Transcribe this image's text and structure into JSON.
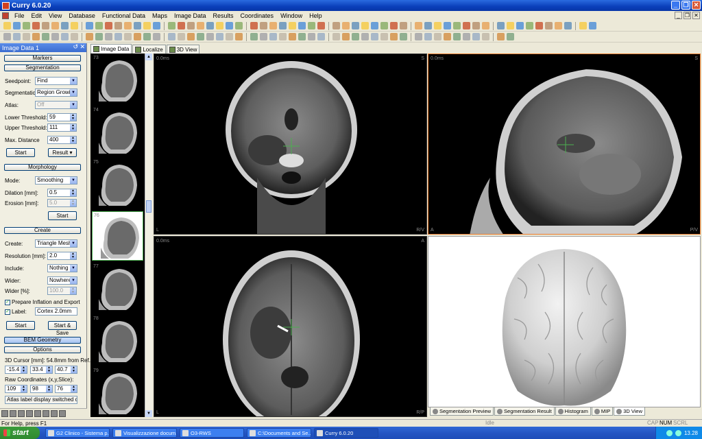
{
  "window": {
    "title": "Curry 6.0.20"
  },
  "menu": [
    "File",
    "Edit",
    "View",
    "Database",
    "Functional Data",
    "Maps",
    "Image Data",
    "Results",
    "Coordinates",
    "Window",
    "Help"
  ],
  "left_panel": {
    "title": "Image Data 1",
    "markers_label": "Markers",
    "segmentation": {
      "header": "Segmentation",
      "seedpoint_label": "Seedpoint:",
      "seedpoint_value": "Find",
      "segmentation_label": "Segmentation:",
      "segmentation_value": "Region Growing",
      "atlas_label": "Atlas:",
      "atlas_value": "Off",
      "lower_label": "Lower Threshold:",
      "lower_value": "59",
      "upper_label": "Upper Threshold:",
      "upper_value": "111",
      "maxdist_label": "Max. Distance",
      "maxdist_value": "400",
      "start_label": "Start",
      "result_label": "Result"
    },
    "morphology": {
      "header": "Morphology",
      "mode_label": "Mode:",
      "mode_value": "Smoothing",
      "dilation_label": "Dilation [mm]:",
      "dilation_value": "0.5",
      "erosion_label": "Erosion [mm]:",
      "erosion_value": "5.0",
      "start_label": "Start"
    },
    "create": {
      "header": "Create",
      "create_label": "Create:",
      "create_value": "Triangle Mesh",
      "resolution_label": "Resolution [mm]:",
      "resolution_value": "2.0",
      "include_label": "Include:",
      "include_value": "Nothing",
      "wider_label": "Wider:",
      "wider_value": "Nowhere",
      "widerpct_label": "Wider [%]:",
      "widerpct_value": "100.0",
      "prepare_label": "Prepare Inflation and Export",
      "label_label": "Label:",
      "label_value": "Cortex 2.0mm",
      "start_label": "Start",
      "start_save_label": "Start & Save"
    },
    "bem_label": "BEM Geometry",
    "options_label": "Options",
    "cursor_label": "3D Cursor [mm]: 54.8mm from Ref.",
    "cursor_values": [
      "-15.4",
      "33.4",
      "40.7"
    ],
    "raw_label": "Raw Coordinates (x,y,Slice):",
    "raw_values": [
      "109",
      "98",
      "76"
    ],
    "atlas_msg": "Atlas label display switched of"
  },
  "tabs": [
    "Image Data",
    "Localize",
    "3D View"
  ],
  "thumbnails": [
    "73",
    "74",
    "75",
    "76",
    "77",
    "78",
    "79"
  ],
  "views": {
    "coronal": {
      "time": "0.0ms",
      "top_right": "S",
      "bottom_left": "L",
      "bottom_right": "R/V"
    },
    "sagittal": {
      "time": "0.0ms",
      "top_right": "S",
      "bottom_left": "A",
      "bottom_right": "P/V"
    },
    "axial": {
      "time": "0.0ms",
      "top_right": "A",
      "bottom_left": "L",
      "bottom_right": "R/P"
    }
  },
  "bottom_tabs": [
    "Segmentation Preview",
    "Segmentation Result",
    "Histogram",
    "MIP",
    "3D View"
  ],
  "status": {
    "help": "For Help, press F1",
    "idle": "Idle",
    "cap": "CAP",
    "num": "NUM",
    "scrl": "SCRL"
  },
  "taskbar": {
    "start": "start",
    "tasks": [
      "G2 Clinico - Sistema p...",
      "Visualizzazione docum...",
      "O3-RWS",
      "C:\\Documents and Se...",
      "Curry 6.0.20"
    ],
    "clock": "13.28"
  }
}
